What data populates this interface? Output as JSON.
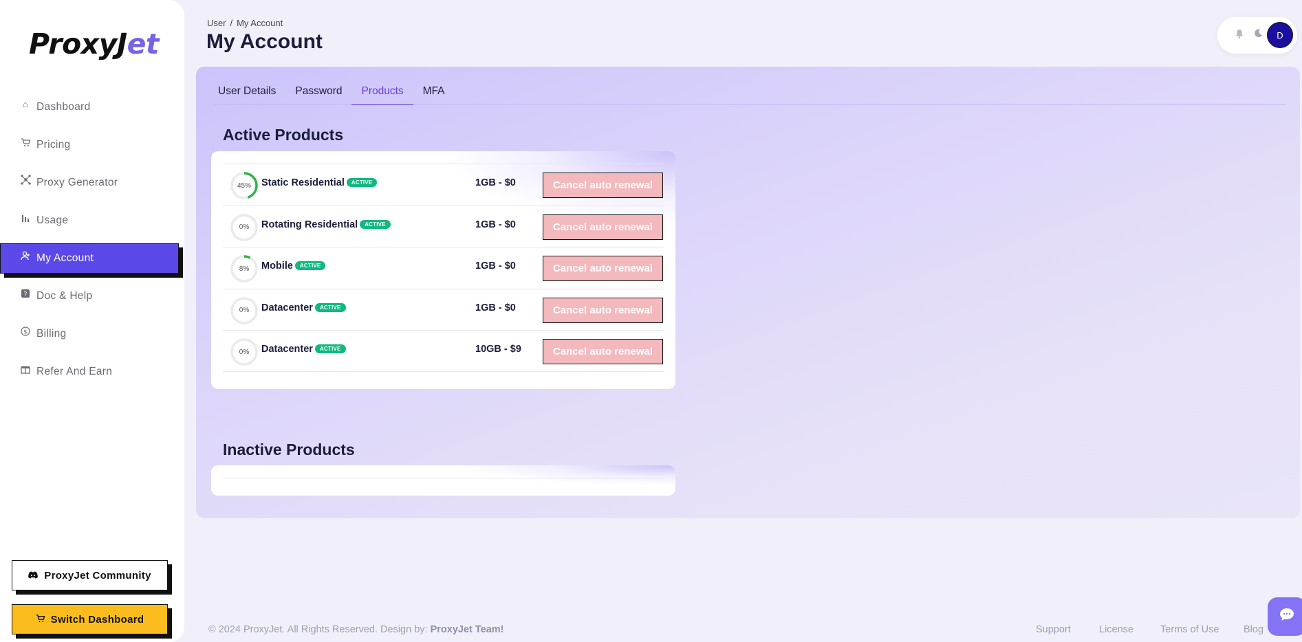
{
  "app": {
    "logo_part1": "ProxyJ",
    "logo_part2": "et"
  },
  "sidebar": {
    "items": [
      {
        "label": "Dashboard",
        "icon": "home-icon"
      },
      {
        "label": "Pricing",
        "icon": "cart-icon"
      },
      {
        "label": "Proxy Generator",
        "icon": "network-icon"
      },
      {
        "label": "Usage",
        "icon": "bar-chart-icon"
      },
      {
        "label": "My Account",
        "icon": "user-icon",
        "active": true
      },
      {
        "label": "Doc & Help",
        "icon": "help-icon"
      },
      {
        "label": "Billing",
        "icon": "dollar-icon"
      },
      {
        "label": "Refer And Earn",
        "icon": "gift-icon"
      }
    ],
    "community_label": "ProxyJet Community",
    "switch_label": "Switch Dashboard"
  },
  "header": {
    "breadcrumb": [
      "User",
      "/",
      "My Account"
    ],
    "title": "My Account",
    "avatar_initial": "D"
  },
  "tabs": [
    {
      "label": "User Details"
    },
    {
      "label": "Password"
    },
    {
      "label": "Products",
      "active": true
    },
    {
      "label": "MFA"
    }
  ],
  "active_products": {
    "title": "Active Products",
    "badge": "ACTIVE",
    "cancel_label": "Cancel auto renewal",
    "rows": [
      {
        "usage": "45%",
        "usage_value": 45,
        "name": "Static Residential",
        "plan": "1GB - $0"
      },
      {
        "usage": "0%",
        "usage_value": 0,
        "name": "Rotating Residential",
        "plan": "1GB - $0"
      },
      {
        "usage": "8%",
        "usage_value": 8,
        "name": "Mobile",
        "plan": "1GB - $0"
      },
      {
        "usage": "0%",
        "usage_value": 0,
        "name": "Datacenter",
        "plan": "1GB - $0"
      },
      {
        "usage": "0%",
        "usage_value": 0,
        "name": "Datacenter",
        "plan": "10GB - $9"
      }
    ]
  },
  "inactive_products": {
    "title": "Inactive Products"
  },
  "footer": {
    "copyright": "© 2024 ProxyJet. All Rights Reserved. Design by: ",
    "team": "ProxyJet Team!",
    "links": [
      "Support",
      "License",
      "Terms of Use",
      "Blog"
    ]
  },
  "colors": {
    "accent": "#5a49e8",
    "active_badge": "#11b981",
    "switch_button": "#fbbd1e",
    "cancel_button": "#f4b9bd",
    "progress": "#2fb24a"
  }
}
